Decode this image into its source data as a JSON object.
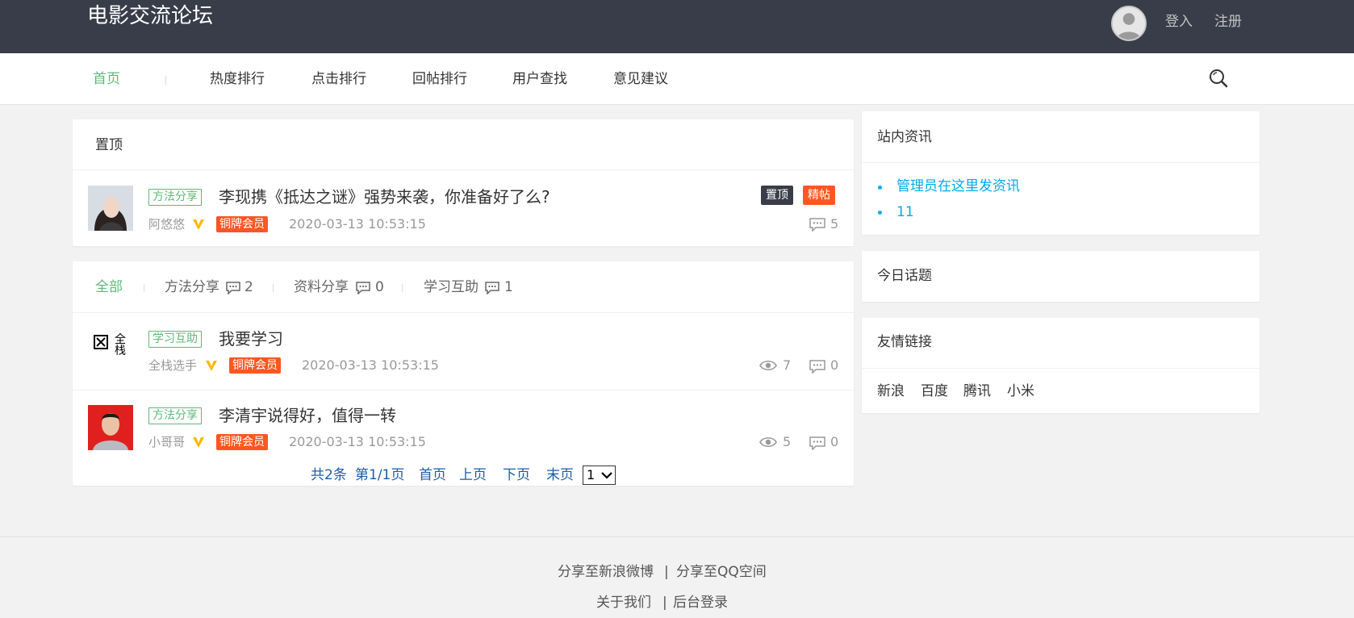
{
  "header": {
    "site_title": "电影交流论坛",
    "login": "登入",
    "register": "注册"
  },
  "nav": {
    "items": [
      "首页",
      "热度排行",
      "点击排行",
      "回帖排行",
      "用户查找",
      "意见建议"
    ]
  },
  "pinned": {
    "title": "置顶",
    "post": {
      "category": "方法分享",
      "title": "李现携《抵达之谜》强势来袭，你准备好了么?",
      "author": "阿悠悠",
      "member": "铜牌会员",
      "time": "2020-03-13 10:53:15",
      "badge_top": "置顶",
      "badge_good": "精帖",
      "comments": "5"
    }
  },
  "tabs": {
    "all": "全部",
    "items": [
      {
        "label": "方法分享",
        "count": "2"
      },
      {
        "label": "资料分享",
        "count": "0"
      },
      {
        "label": "学习互助",
        "count": "1"
      }
    ]
  },
  "posts": [
    {
      "category": "学习互助",
      "title": "我要学习",
      "author": "全栈选手",
      "member": "铜牌会员",
      "time": "2020-03-13 10:53:15",
      "views": "7",
      "comments": "0",
      "avatar_alt": "全栈"
    },
    {
      "category": "方法分享",
      "title": "李清宇说得好，值得一转",
      "author": "小哥哥",
      "member": "铜牌会员",
      "time": "2020-03-13 10:53:15",
      "views": "5",
      "comments": "0"
    }
  ],
  "pagination": {
    "total": "共2条",
    "page_info": "第1/1页",
    "first": "首页",
    "prev": "上页",
    "next": "下页",
    "last": "末页",
    "selected": "1"
  },
  "sidebar": {
    "news_title": "站内资讯",
    "news": [
      "管理员在这里发资讯",
      "11"
    ],
    "today_title": "今日话题",
    "links_title": "友情链接",
    "links": [
      "新浪",
      "百度",
      "腾讯",
      "小米"
    ]
  },
  "footer": {
    "share_weibo": "分享至新浪微博",
    "share_qq": "分享至QQ空间",
    "about": "关于我们",
    "admin_login": "后台登录",
    "separator": "|"
  },
  "colors": {
    "header_bg": "#393d49",
    "accent_green": "#5fb878",
    "orange": "#ff5722",
    "link_blue": "#01aaed",
    "page_blue": "#1a5ea8",
    "vip_gold": "#ffb800"
  }
}
